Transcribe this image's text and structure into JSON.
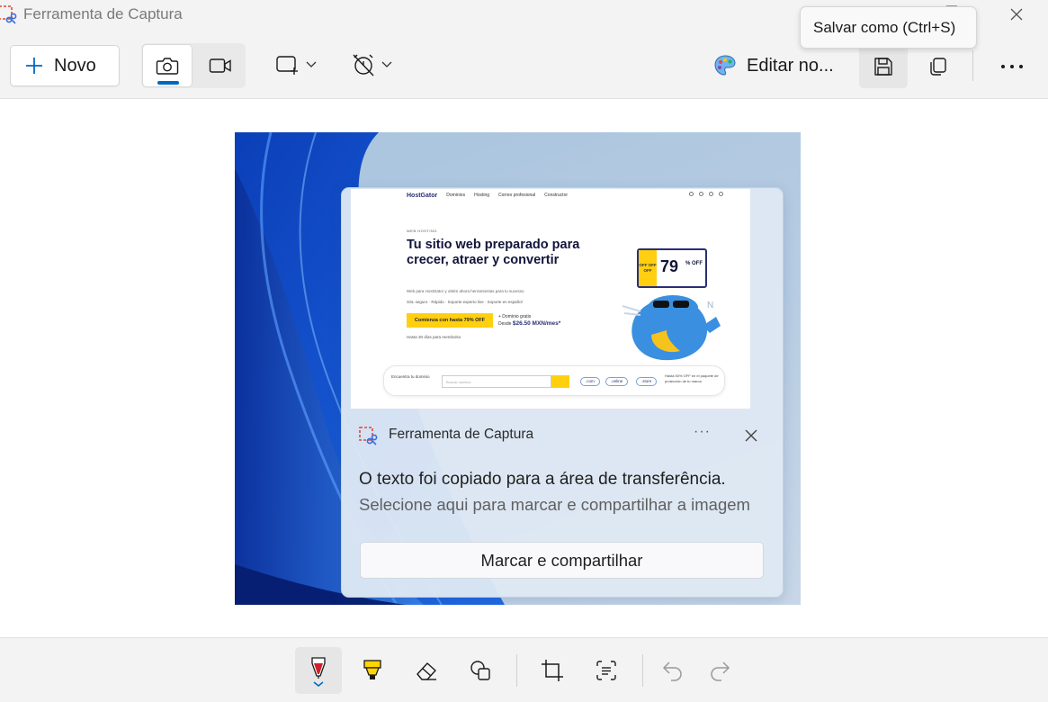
{
  "window": {
    "title": "Ferramenta de Captura",
    "tooltip": "Salvar como (Ctrl+S)"
  },
  "toolbar": {
    "new_label": "Novo",
    "edit_label": "Editar no...",
    "active_mode": "photo"
  },
  "icons": {
    "app": "snipping-tool-icon",
    "new": "plus-icon",
    "photo": "camera-icon",
    "video": "video-icon",
    "snip_shape": "rectangle-snip-icon",
    "delay": "timer-off-icon",
    "paint": "paint-palette-icon",
    "save": "save-icon",
    "copy": "copy-icon",
    "more": "more-icon"
  },
  "screenshot": {
    "site": {
      "logo": "HostGator",
      "nav_items": [
        "Dominios",
        "Hosting",
        "Correo profesional",
        "Constructor"
      ],
      "kicker": "WEB HOSTING",
      "headline": "Tu sitio web preparado para crecer, atraer y convertir",
      "subtext": "Web para HostGator y obtén ahora herramientas para tu sucesso",
      "bullets": "SSL seguro  ·  Rápido  ·  Soporte experto live  ·  Soporte en español",
      "cta": "Comienza con hasta 79% OFF",
      "price_line1": "+ Dominio gratis",
      "price_prefix": "Desde",
      "price": "$26.50 MXN/mes*",
      "trial": "Hasta 30 días para reembolso",
      "offer_tag": "OFF OFF OFF",
      "offer_pct": "79",
      "offer_off": "% OFF",
      "search_prompt": "Encuentra tu dominio",
      "search_placeholder": "Buscar dominio",
      "tlds": [
        ".com",
        ".online",
        ".store"
      ],
      "promo": "Hasta 50% OFF en el paquete de protección de tu marca"
    },
    "notification": {
      "app_name": "Ferramenta de Captura",
      "more": "···",
      "message": "O texto foi copiado para a área de transferência.",
      "sub": "Selecione aqui para marcar e compartilhar a imagem",
      "action": "Marcar e compartilhar"
    }
  },
  "bottom_tools": [
    "ballpoint-pen",
    "highlighter",
    "eraser",
    "shapes",
    "crop",
    "text-actions",
    "undo",
    "redo"
  ],
  "colors": {
    "accent": "#0067c0",
    "pen_red": "#d0202b",
    "highlighter_yellow": "#ffd400",
    "toolbar_bg": "#f3f3f3"
  }
}
